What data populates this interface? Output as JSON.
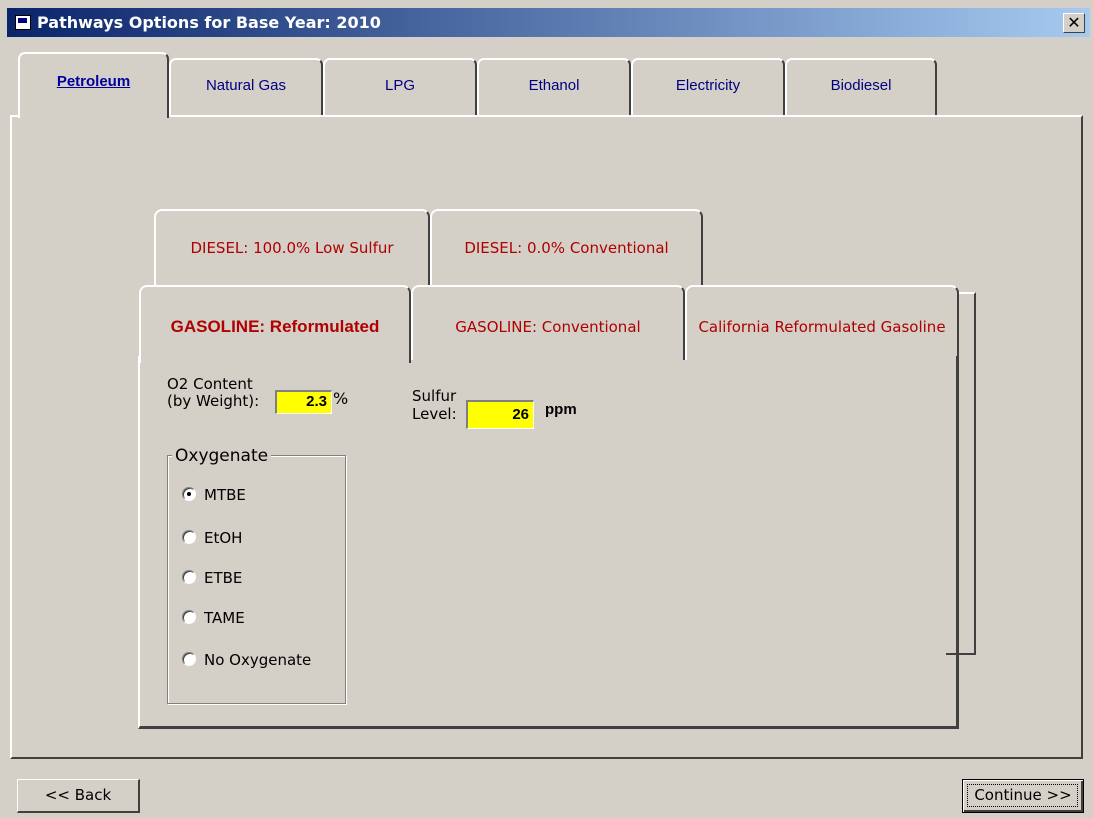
{
  "window": {
    "title": "Pathways Options for Base Year: 2010",
    "close_glyph": "✕"
  },
  "main_tabs": [
    {
      "label": "Petroleum",
      "active": true
    },
    {
      "label": "Natural Gas"
    },
    {
      "label": "LPG"
    },
    {
      "label": "Ethanol"
    },
    {
      "label": "Electricity"
    },
    {
      "label": "Biodiesel"
    }
  ],
  "sub_tabs_back": [
    {
      "label": "DIESEL: 100.0% Low Sulfur"
    },
    {
      "label": "DIESEL: 0.0% Conventional"
    }
  ],
  "sub_tabs_front": [
    {
      "label": "GASOLINE: Reformulated",
      "active": true
    },
    {
      "label": "GASOLINE: Conventional"
    },
    {
      "label": "California Reformulated Gasoline"
    }
  ],
  "form": {
    "o2_label_line1": "O2 Content",
    "o2_label_line2": "(by Weight):",
    "o2_value": "2.3",
    "o2_unit": "%",
    "sulfur_label_line1": "Sulfur",
    "sulfur_label_line2": "Level:",
    "sulfur_value": "26",
    "sulfur_unit": "ppm"
  },
  "oxygenate": {
    "title": "Oxygenate",
    "options": [
      "MTBE",
      "EtOH",
      "ETBE",
      "TAME",
      "No Oxygenate"
    ],
    "selected": "MTBE"
  },
  "buttons": {
    "back": "<< Back",
    "continue": "Continue >>"
  }
}
